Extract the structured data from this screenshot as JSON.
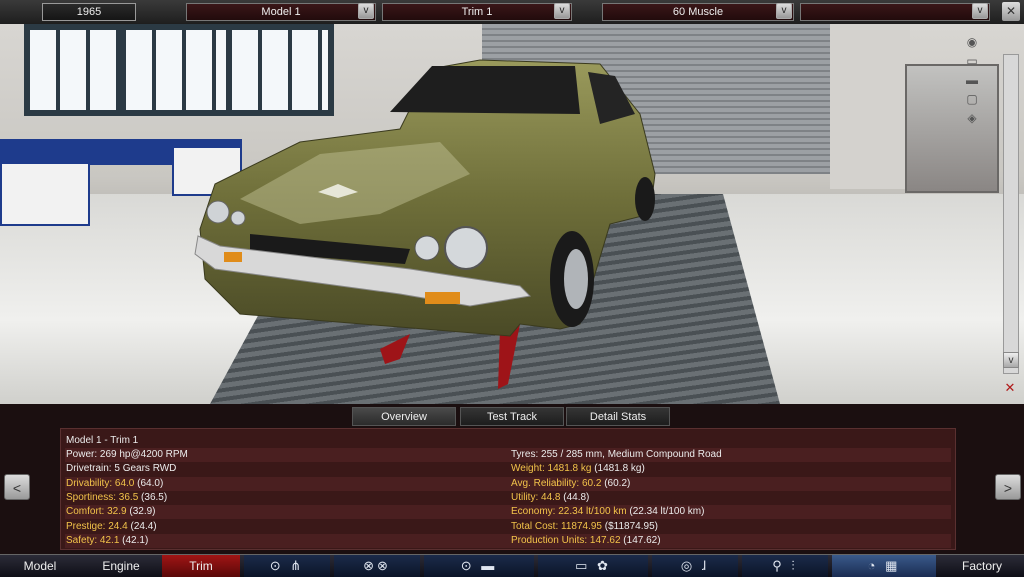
{
  "topbar": {
    "year": "1965",
    "model": "Model 1",
    "trim": "Trim 1",
    "body": "60 Muscle",
    "extra": "",
    "dropdown_glyph": "v",
    "close_glyph": "✕"
  },
  "scene": {
    "view_icons": [
      "camera-record-icon",
      "car-front-icon",
      "car-side-icon",
      "car-top-icon",
      "car-angle-icon"
    ],
    "scroll_down_glyph": "v"
  },
  "tabs": [
    "Overview",
    "Test Track",
    "Detail Stats"
  ],
  "active_tab": "Overview",
  "stats": {
    "title": "Model 1 - Trim 1",
    "left": [
      {
        "label": "Power:",
        "value": " 269 hp@4200 RPM",
        "highlight": false
      },
      {
        "label": "Drivetrain:",
        "value": " 5 Gears RWD",
        "highlight": false
      },
      {
        "label": "Drivability:",
        "value": " 64.0",
        "extra": " (64.0)",
        "highlight": true
      },
      {
        "label": "Sportiness:",
        "value": " 36.5",
        "extra": " (36.5)",
        "highlight": true
      },
      {
        "label": "Comfort:",
        "value": " 32.9",
        "extra": " (32.9)",
        "highlight": true
      },
      {
        "label": "Prestige:",
        "value": " 24.4",
        "extra": " (24.4)",
        "highlight": true
      },
      {
        "label": "Safety:",
        "value": " 42.1",
        "extra": " (42.1)",
        "highlight": true
      }
    ],
    "right": [
      {
        "label": "Tyres:",
        "value": " 255 / 285 mm, Medium Compound Road",
        "highlight": false
      },
      {
        "label": "Weight:",
        "value": " 1481.8 kg",
        "extra": " (1481.8 kg)",
        "highlight": true
      },
      {
        "label": "Avg. Reliability:",
        "value": " 60.2",
        "extra": " (60.2)",
        "highlight": true
      },
      {
        "label": "Utility:",
        "value": " 44.8",
        "extra": " (44.8)",
        "highlight": true
      },
      {
        "label": "Economy:",
        "value": " 22.34 lt/100 km",
        "extra": " (22.34 lt/100 km)",
        "highlight": true
      },
      {
        "label": "Total Cost:",
        "value": " 11874.95",
        "extra": " ($11874.95)",
        "highlight": true
      },
      {
        "label": "Production Units:",
        "value": " 147.62",
        "extra": " (147.62)",
        "highlight": true
      }
    ],
    "prev_glyph": "<",
    "next_glyph": ">"
  },
  "nav": {
    "items": [
      "Model",
      "Engine",
      "Trim",
      "",
      "",
      "",
      "",
      "",
      "",
      "",
      "Factory"
    ],
    "icon_groups": [
      {
        "name": "chassis-gearbox-icons",
        "glyphs": "⊙ ⋔"
      },
      {
        "name": "wheels-icons",
        "glyphs": "⊗⊗"
      },
      {
        "name": "body-icons",
        "glyphs": "⊙ ▬"
      },
      {
        "name": "car-fan-icons",
        "glyphs": "▭ ✿"
      },
      {
        "name": "steering-seat-icons",
        "glyphs": "◎ ɺ"
      },
      {
        "name": "suspension-icons",
        "glyphs": "⚲ ⫶"
      },
      {
        "name": "testing-icons",
        "glyphs": "◔ ▦"
      }
    ]
  },
  "colors": {
    "accent_red": "#a01515",
    "stat_highlight": "#f2c34a",
    "panel_bg": "#3a1818"
  }
}
